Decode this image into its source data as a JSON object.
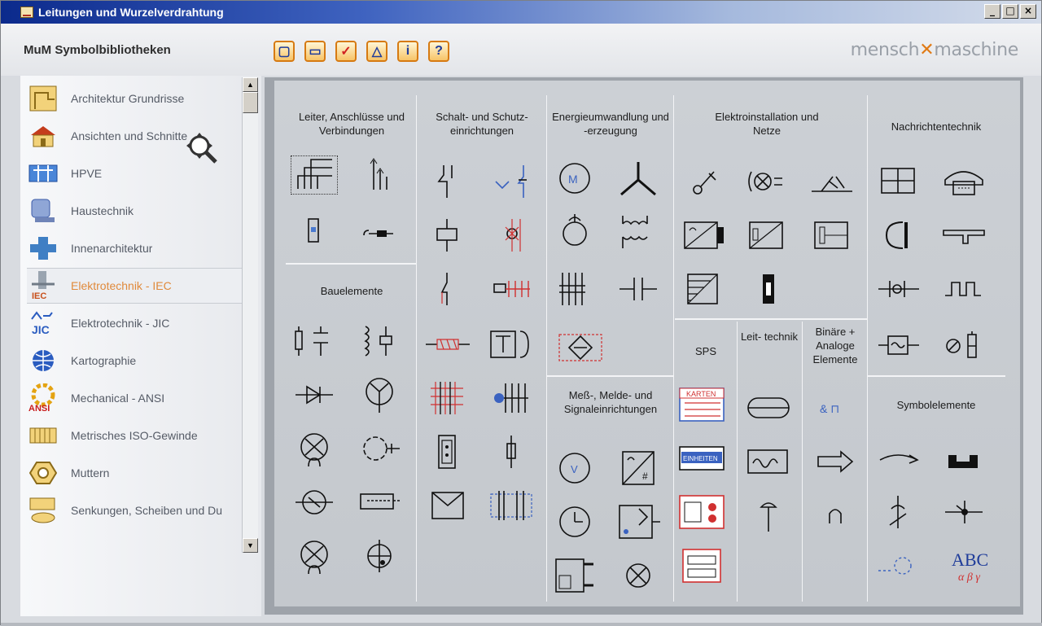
{
  "window": {
    "title": "Leitungen und Wurzelverdrahtung",
    "buttons": {
      "minimize": "_",
      "maximize": "□",
      "close": "×"
    }
  },
  "toolbar": {
    "library_title": "MuM Symbolbibliotheken",
    "buttons": [
      "▢",
      "▭",
      "✓",
      "△",
      "i",
      "?"
    ],
    "logo_left": "mensch",
    "logo_mark": "✕",
    "logo_right": "maschine"
  },
  "sidebar": {
    "items": [
      {
        "label": "Architektur Grundrisse",
        "icon": "floorplan-icon"
      },
      {
        "label": "Ansichten und Schnitte",
        "icon": "house-icon"
      },
      {
        "label": "HPVE",
        "icon": "hpve-icon"
      },
      {
        "label": "Haustechnik",
        "icon": "haustechnik-icon"
      },
      {
        "label": "Innenarchitektur",
        "icon": "interior-icon"
      },
      {
        "label": "Elektrotechnik - IEC",
        "icon": "iec-icon",
        "badge": "IEC"
      },
      {
        "label": "Elektrotechnik - JIC",
        "icon": "jic-icon",
        "badge": "JIC"
      },
      {
        "label": "Kartographie",
        "icon": "globe-icon"
      },
      {
        "label": "Mechanical - ANSI",
        "icon": "gear-icon",
        "badge": "ANSI"
      },
      {
        "label": "Metrisches ISO-Gewinde",
        "icon": "thread-icon"
      },
      {
        "label": "Muttern",
        "icon": "nut-icon"
      },
      {
        "label": "Senkungen, Scheiben und Du",
        "icon": "washer-icon"
      }
    ]
  },
  "categories": {
    "leiter": "Leiter, Anschlüsse und Verbindungen",
    "schalt": "Schalt- und Schutz- einrichtungen",
    "energie": "Energieumwandlung und -erzeugung",
    "elektro": "Elektroinstallation und Netze",
    "nachricht": "Nachrichtentechnik",
    "bauelemente": "Bauelemente",
    "sps": "SPS",
    "leit": "Leit- technik",
    "binaer": "Binäre + Analoge Elemente",
    "mess": "Meß-, Melde- und Signaleinrichtungen",
    "symbol": "Symbolelemente"
  },
  "symbol_text": {
    "karten": "KARTEN",
    "einheiten": "EINHEITEN",
    "abc": "ABC",
    "greek": "α β γ",
    "binary": "& ⊓"
  }
}
